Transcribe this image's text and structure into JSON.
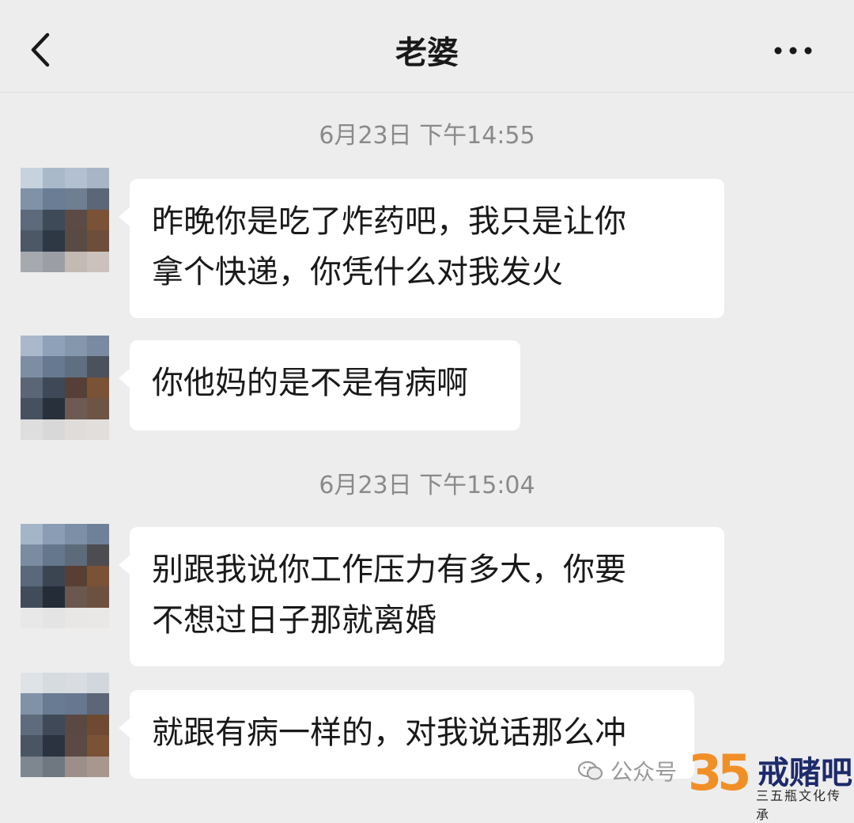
{
  "header": {
    "title": "老婆",
    "back_icon": "chevron-left-icon",
    "more_icon": "more-horizontal-icon"
  },
  "messages": {
    "timestamp_1": "6月23日 下午14:55",
    "msg_1_line1": "昨晚你是吃了炸药吧，我只是让你",
    "msg_1_line2": "拿个快递，你凭什么对我发火",
    "msg_2": "你他妈的是不是有病啊",
    "timestamp_2": "6月23日 下午15:04",
    "msg_3_line1": "别跟我说你工作压力有多大，你要",
    "msg_3_line2": "不想过日子那就离婚",
    "msg_4": "就跟有病一样的，对我说话那么冲"
  },
  "watermark": {
    "account_label": "公众号",
    "logo_number": "35",
    "logo_name": "戒赌吧",
    "slogan": "三五瓶文化传承"
  },
  "colors": {
    "background": "#ededed",
    "bubble": "#ffffff",
    "text": "#191919",
    "timestamp": "#8a8a8a"
  }
}
